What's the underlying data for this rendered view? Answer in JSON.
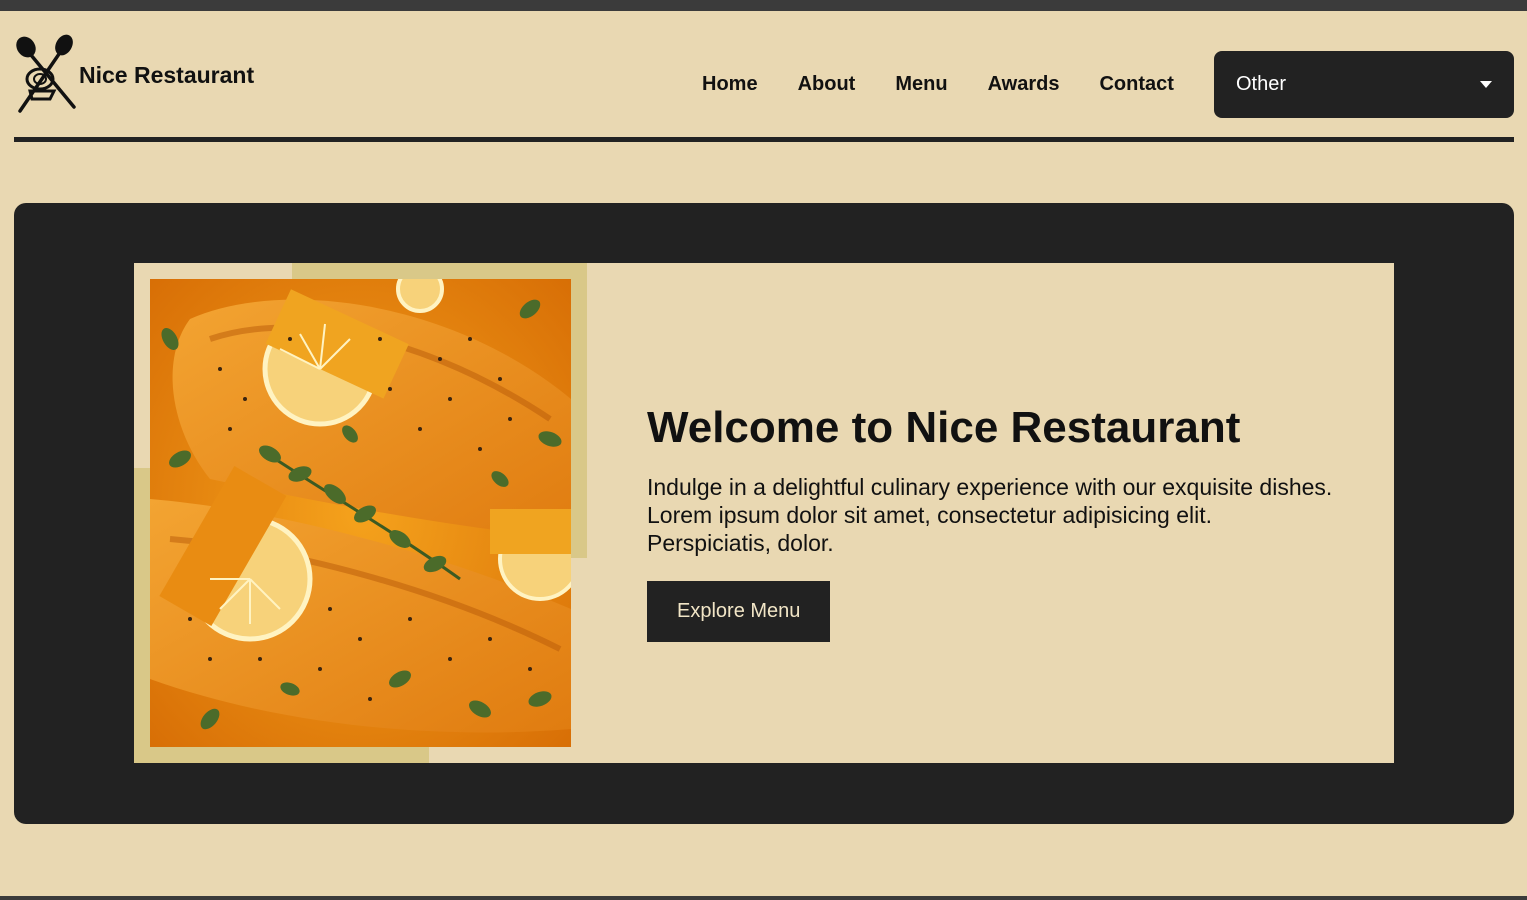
{
  "header": {
    "brand_name": "Nice Restaurant",
    "logo_icon": "crossed-spoon-fork-icon",
    "nav": [
      "Home",
      "About",
      "Menu",
      "Awards",
      "Contact"
    ],
    "select": {
      "value": "Other",
      "icon": "caret-down-icon"
    }
  },
  "hero": {
    "title": "Welcome to Nice Restaurant",
    "description": "Indulge in a delightful culinary experience with our exquisite dishes. Lorem ipsum dolor sit amet, consectetur adipisicing elit. Perspiciatis, dolor.",
    "cta_label": "Explore Menu",
    "image": "salmon-dish-photo"
  },
  "colors": {
    "background": "#e9d8b2",
    "dark": "#222222",
    "frame_accent": "#d9c888",
    "cta_text": "#f1e5c6"
  }
}
